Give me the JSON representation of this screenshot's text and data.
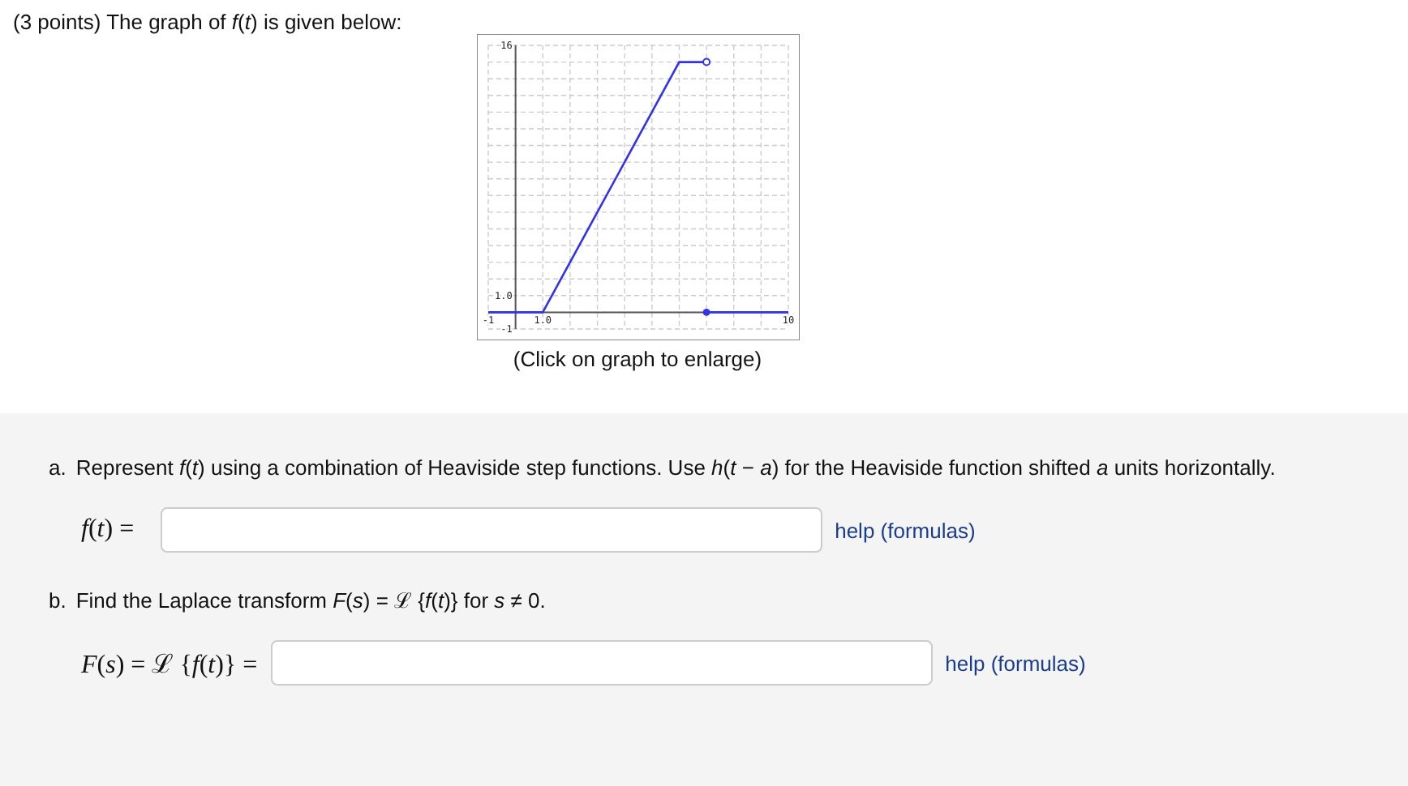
{
  "header": {
    "text": "(3 points) The graph of *f*(*t*) is given below:"
  },
  "graph": {
    "caption": "(Click on graph to enlarge)",
    "chart_data": {
      "type": "line",
      "x": [
        -1,
        1,
        6,
        7,
        10
      ],
      "series": [
        {
          "color": "#3333ee",
          "values": [
            0,
            0,
            15,
            15,
            null
          ]
        },
        {
          "color": "#3333ee",
          "values": [
            null,
            null,
            null,
            0,
            0
          ]
        }
      ],
      "xlim": [
        -1,
        10
      ],
      "ylim": [
        -1,
        16
      ],
      "xticks": [
        {
          "value": -1,
          "label": "-1"
        },
        {
          "value": 1,
          "label": "1.0"
        },
        {
          "value": 10,
          "label": "10"
        }
      ],
      "yticks": [
        {
          "value": -1,
          "label": "-1"
        },
        {
          "value": 1,
          "label": "1.0"
        },
        {
          "value": 16,
          "label": "16"
        }
      ]
    }
  },
  "parts": [
    {
      "marker": "a.",
      "prompt": "Represent *f*(*t*) using a combination of Heaviside step functions. Use *h*(*t* − *a*) for the Heaviside function shifted *a* units horizontally.",
      "label": "*f*(*t*) =",
      "help": "help (formulas)"
    },
    {
      "marker": "b.",
      "prompt": "Find the Laplace transform *F*(*s*) = ℒ {*f*(*t*)} for *s* ≠ 0.",
      "label": "*F*(*s*) = ℒ {*f*(*t*)} =",
      "help": "help (formulas)"
    }
  ]
}
